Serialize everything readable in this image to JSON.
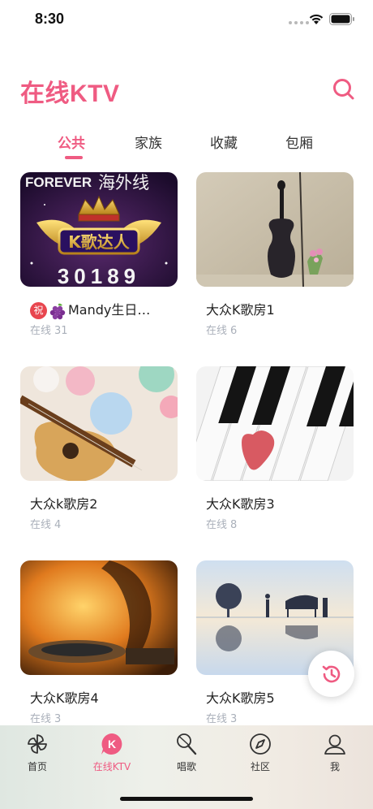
{
  "status_bar": {
    "time": "8:30"
  },
  "header": {
    "title": "在线KTV"
  },
  "tabs": [
    {
      "label": "公共",
      "active": true
    },
    {
      "label": "家族",
      "active": false
    },
    {
      "label": "收藏",
      "active": false
    },
    {
      "label": "包厢",
      "active": false
    }
  ],
  "rooms": [
    {
      "name": "Mandy生日…",
      "badge": "祝",
      "online_label": "在线",
      "online_count": "31",
      "thumb_text_top": "FOREVER",
      "thumb_text_top2": "海外线",
      "thumb_logo": "K歌达人",
      "thumb_number": "30189"
    },
    {
      "name": "大众K歌房1",
      "online_label": "在线",
      "online_count": "6"
    },
    {
      "name": "大众k歌房2",
      "online_label": "在线",
      "online_count": "4"
    },
    {
      "name": "大众K歌房3",
      "online_label": "在线",
      "online_count": "8"
    },
    {
      "name": "大众K歌房4",
      "online_label": "在线",
      "online_count": "3"
    },
    {
      "name": "大众K歌房5",
      "online_label": "在线",
      "online_count": "3"
    }
  ],
  "bottom_nav": [
    {
      "label": "首页",
      "icon": "pinwheel-icon",
      "active": false
    },
    {
      "label": "在线KTV",
      "icon": "ktv-k-icon",
      "active": true
    },
    {
      "label": "唱歌",
      "icon": "microphone-icon",
      "active": false
    },
    {
      "label": "社区",
      "icon": "compass-icon",
      "active": false
    },
    {
      "label": "我",
      "icon": "user-icon",
      "active": false
    }
  ],
  "colors": {
    "accent": "#ef5b82",
    "muted_text": "#aab0ba"
  }
}
